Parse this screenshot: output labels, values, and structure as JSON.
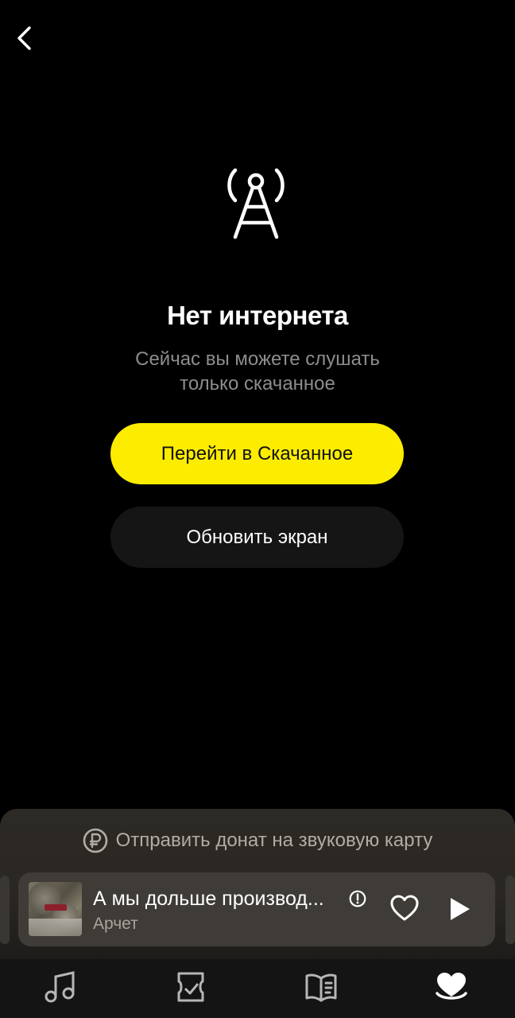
{
  "screen": {
    "title": "Нет интернета",
    "subtitle_line1": "Сейчас вы можете слушать",
    "subtitle_line2": "только скачанное",
    "primary_button": "Перейти в Скачанное",
    "secondary_button": "Обновить экран"
  },
  "icons": {
    "back": "chevron-left-icon",
    "signal": "radio-tower-icon",
    "donate": "ruble-coin-icon",
    "info": "exclamation-circle-icon",
    "like": "heart-outline-icon",
    "play": "play-icon"
  },
  "player": {
    "donate_label": "Отправить донат на звуковую карту",
    "track_title": "А мы дольше производ...",
    "artist": "Арчет"
  },
  "tabbar": {
    "tabs": [
      {
        "icon": "music-note-icon",
        "active": false
      },
      {
        "icon": "collection-icon",
        "active": false
      },
      {
        "icon": "book-icon",
        "active": false
      },
      {
        "icon": "heart-icon",
        "active": true
      }
    ]
  },
  "colors": {
    "accent": "#fced00",
    "background": "#000000",
    "subtitle": "#8d8d8d"
  }
}
